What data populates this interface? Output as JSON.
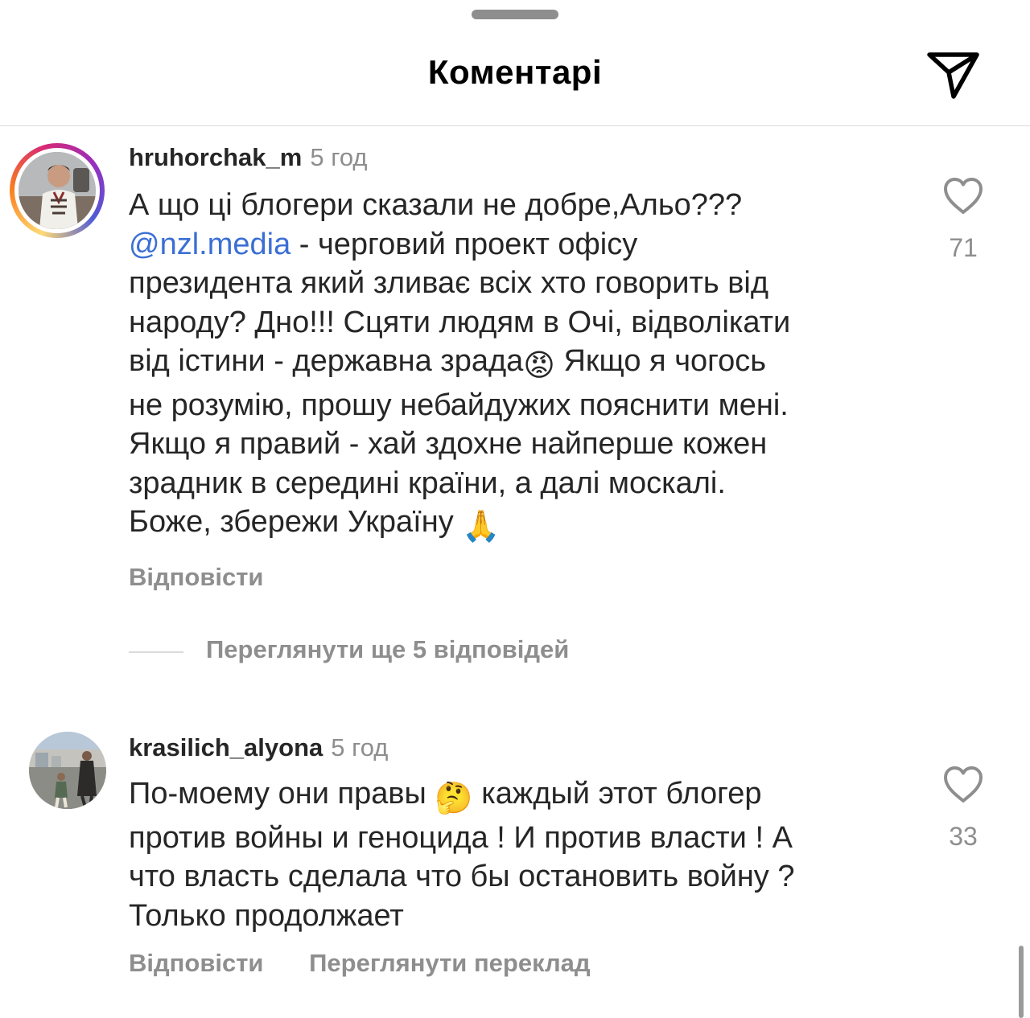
{
  "header": {
    "title": "Коментарі",
    "share_icon": "paper-plane-icon"
  },
  "comments": [
    {
      "username": "hruhorchak_m",
      "time": "5 год",
      "line1": "А що ці блогери сказали не добре,Альо???",
      "mention": "@nzl.media",
      "text_after_mention": " - черговий проект офісу\nпрезидента який зливає всіх хто говорить від\nнароду? Дно!!! Сцяти людям в Очі, відволікати\nвід істини - державна зрада",
      "emoji_1": "😡",
      "text_after_emoji_1": " Якщо я чогось\nне розумію, прошу небайдужих пояснити мені.\nЯкщо я правий - хай здохне найперше кожен\nзрадник в середині країни, а далі москалі.\nБоже, збережи Україну ",
      "emoji_2": "🙏",
      "reply_label": "Відповісти",
      "likes": "71",
      "view_replies": "Переглянути ще 5 відповідей",
      "has_story_ring": true
    },
    {
      "username": "krasilich_alyona",
      "time": "5 год",
      "text_before_emoji": "По-моему они правы ",
      "emoji_1": "🤔",
      "text_after_emoji": " каждый этот блогер\nпротив войны и геноцида ! И против власти ! А\nчто власть сделала что бы остановить войну ?\nТолько продолжает",
      "reply_label": "Відповісти",
      "translate_label": "Переглянути переклад",
      "likes": "33",
      "has_story_ring": false
    }
  ],
  "colors": {
    "text": "#262626",
    "secondary": "#8e8e8e",
    "mention": "#3b6fd4",
    "divider": "#dbdbdb"
  }
}
